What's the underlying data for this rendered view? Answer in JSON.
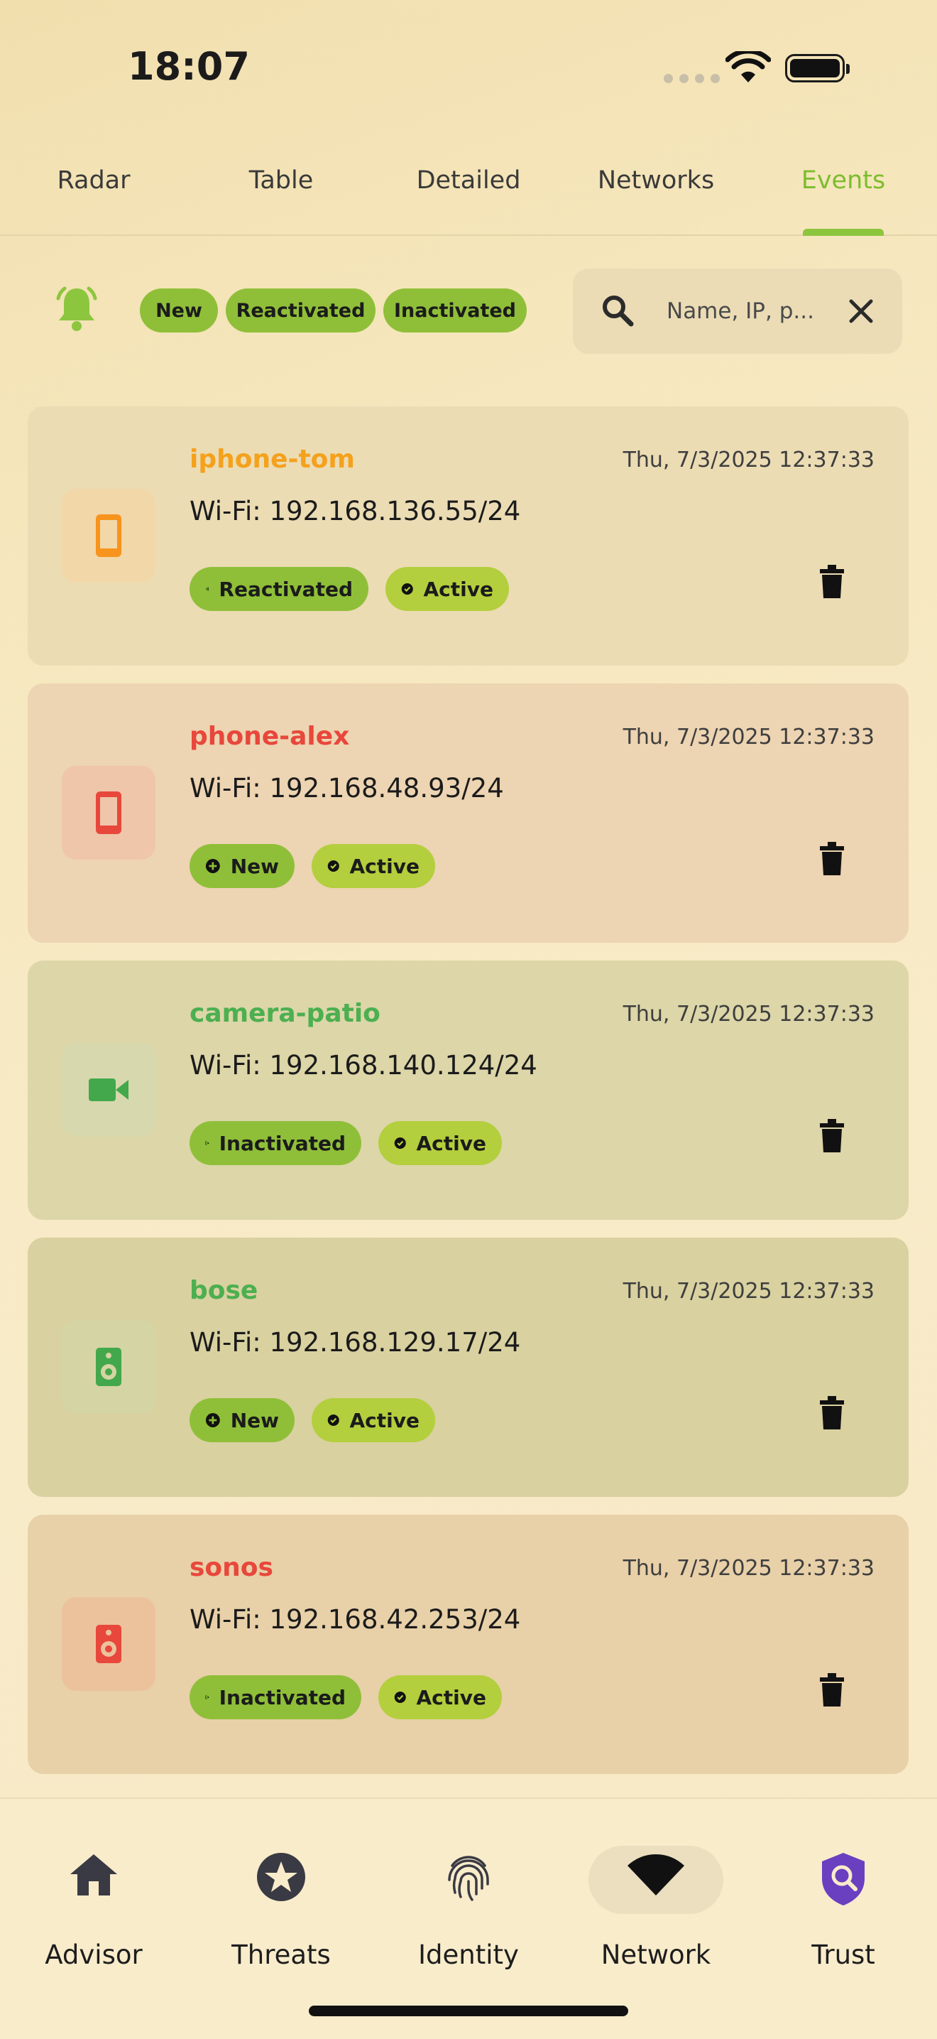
{
  "status_bar": {
    "time": "18:07"
  },
  "tabs": [
    {
      "label": "Radar"
    },
    {
      "label": "Table"
    },
    {
      "label": "Detailed"
    },
    {
      "label": "Networks"
    },
    {
      "label": "Events",
      "active": true
    }
  ],
  "filters": {
    "chips": [
      "New",
      "Reactivated",
      "Inactivated"
    ],
    "search_placeholder": "Name, IP, p..."
  },
  "events": [
    {
      "name": "iphone-tom",
      "name_color": "#f5a11c",
      "icon": "phone-icon",
      "icon_color": "#f7941d",
      "icon_bg": "#f2d7a8",
      "timestamp": "Thu, 7/3/2025 12:37:33",
      "address": "Wi-Fi: 192.168.136.55/24",
      "event": "Reactivated",
      "event_icon": "login-icon",
      "status": "Active",
      "card_bg": "#ebdcb4"
    },
    {
      "name": "phone-alex",
      "name_color": "#e8473c",
      "icon": "phone-icon",
      "icon_color": "#e8473c",
      "icon_bg": "#efc6aa",
      "timestamp": "Thu, 7/3/2025 12:37:33",
      "address": "Wi-Fi: 192.168.48.93/24",
      "event": "New",
      "event_icon": "plus-circle-icon",
      "status": "Active",
      "card_bg": "#edd4b2"
    },
    {
      "name": "camera-patio",
      "name_color": "#4caf50",
      "icon": "video-camera-icon",
      "icon_color": "#43a84b",
      "icon_bg": "#d7d8ad",
      "timestamp": "Thu, 7/3/2025 12:37:33",
      "address": "Wi-Fi: 192.168.140.124/24",
      "event": "Inactivated",
      "event_icon": "logout-icon",
      "status": "Active",
      "card_bg": "#dcd6a8"
    },
    {
      "name": "bose",
      "name_color": "#4caf50",
      "icon": "speaker-icon",
      "icon_color": "#43a84b",
      "icon_bg": "#d5d4a4",
      "timestamp": "Thu, 7/3/2025 12:37:33",
      "address": "Wi-Fi: 192.168.129.17/24",
      "event": "New",
      "event_icon": "plus-circle-icon",
      "status": "Active",
      "card_bg": "#d9d1a0"
    },
    {
      "name": "sonos",
      "name_color": "#e8473c",
      "icon": "speaker-icon",
      "icon_color": "#e8473c",
      "icon_bg": "#ecc29c",
      "timestamp": "Thu, 7/3/2025 12:37:33",
      "address": "Wi-Fi: 192.168.42.253/24",
      "event": "Inactivated",
      "event_icon": "logout-icon",
      "status": "Active",
      "card_bg": "#e8d0a8"
    }
  ],
  "bottom_nav": [
    {
      "label": "Advisor",
      "icon": "home-icon"
    },
    {
      "label": "Threats",
      "icon": "star-badge-icon"
    },
    {
      "label": "Identity",
      "icon": "fingerprint-icon"
    },
    {
      "label": "Network",
      "icon": "wifi-icon",
      "selected": true
    },
    {
      "label": "Trust",
      "icon": "shield-search-icon",
      "icon_color": "#6a3fc0"
    }
  ]
}
